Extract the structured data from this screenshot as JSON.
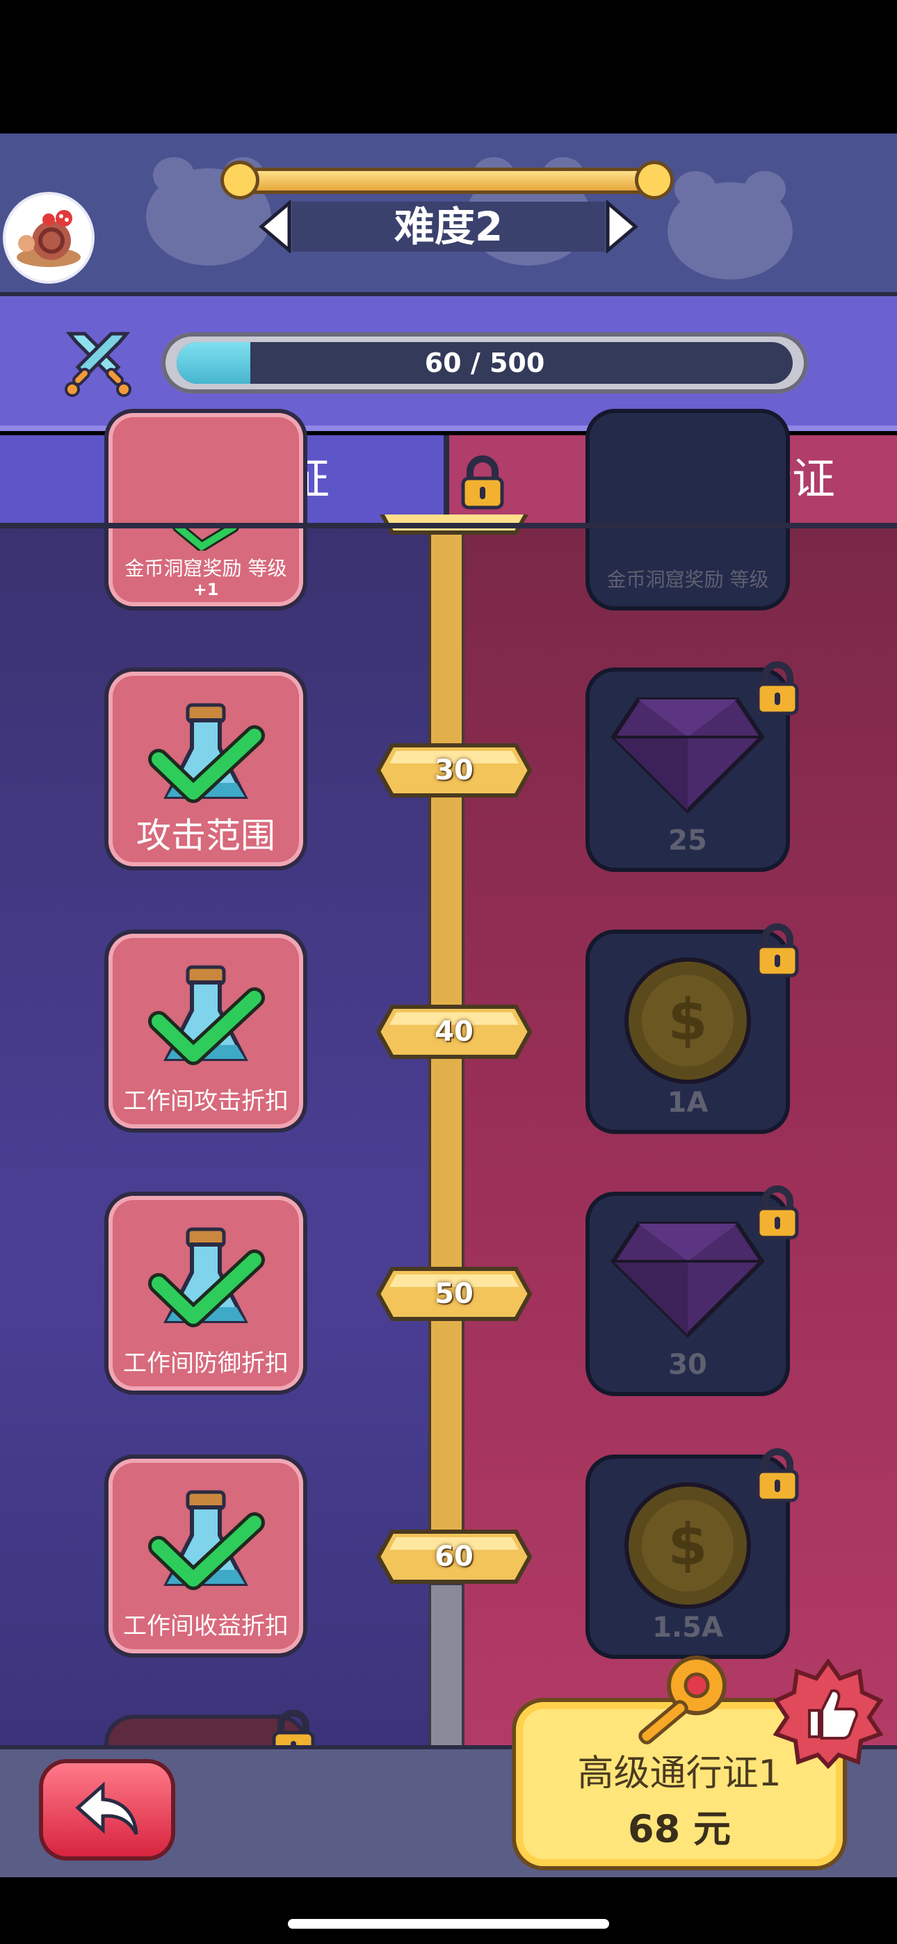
{
  "difficulty": {
    "label": "难度2"
  },
  "progress": {
    "text": "60 / 500",
    "current": 60,
    "max": 500
  },
  "tabs": {
    "free": "免费通行证",
    "premium": "高级通行证"
  },
  "rows": [
    {
      "level": "",
      "free_label": "金币洞窟奖励 等级",
      "free_sub": "+1",
      "premium_label": "金币洞窟奖励 等级"
    },
    {
      "level": "30",
      "free_label": "攻击范围",
      "premium_value": "25",
      "premium_icon": "gem-icon"
    },
    {
      "level": "40",
      "free_label": "工作间攻击折扣",
      "premium_value": "1A",
      "premium_icon": "coin-icon"
    },
    {
      "level": "50",
      "free_label": "工作间防御折扣",
      "premium_value": "30",
      "premium_icon": "gem-icon"
    },
    {
      "level": "60",
      "free_label": "工作间收益折扣",
      "premium_value": "1.5A",
      "premium_icon": "coin-icon"
    }
  ],
  "purchase": {
    "title": "高级通行证1",
    "price": "68 元"
  },
  "colors": {
    "free_bg": "#4b3f95",
    "premium_bg": "#9a2f57",
    "track": "#e2b04a",
    "check": "#2ecc5a"
  }
}
